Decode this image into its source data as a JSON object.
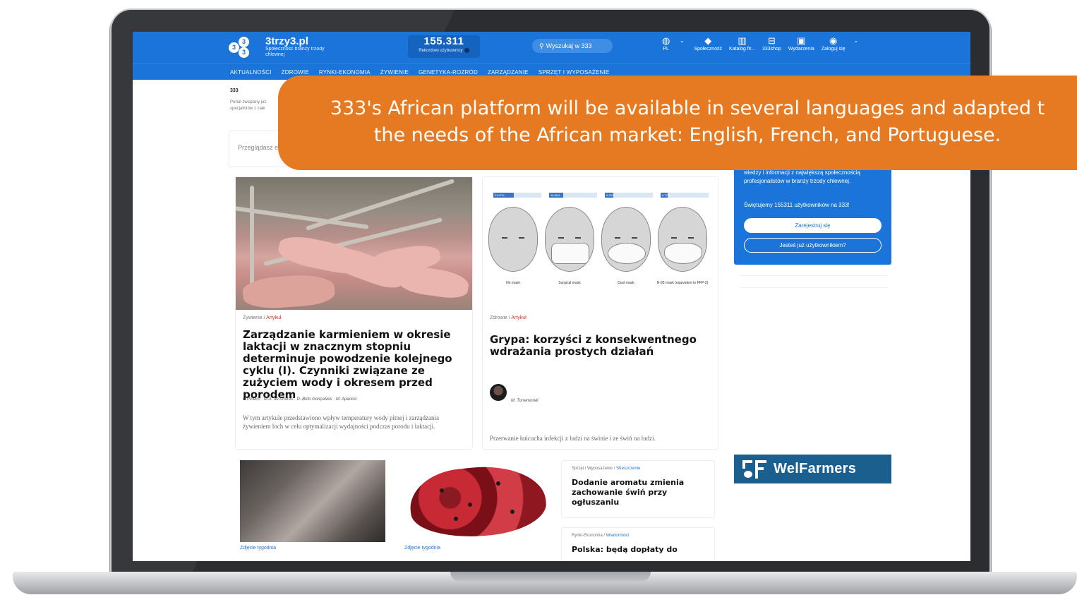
{
  "site": {
    "logo_name": "3trzy3.pl",
    "logo_tagline": "Społeczność branży trzody chlewnej",
    "counter_value": "155.311",
    "counter_label": "Rekordowi użytkownicy",
    "search_placeholder": "Wyszukaj w 333",
    "nav": [
      {
        "label": "PL",
        "icon": "globe-icon"
      },
      {
        "label": "Społeczność",
        "icon": "community-icon"
      },
      {
        "label": "Katalog fir...",
        "icon": "catalog-icon"
      },
      {
        "label": "333shop",
        "icon": "shop-icon"
      },
      {
        "label": "Wydarzenia",
        "icon": "calendar-icon"
      },
      {
        "label": "Zaloguj się",
        "icon": "user-icon"
      }
    ],
    "menu": [
      "AKTUALNOŚCI",
      "ZDROWIE",
      "RYNKI-EKONOMIA",
      "ŻYWIENIE",
      "GENETYKA-ROZRÓD",
      "ZARZĄDZANIE",
      "SPRZĘT I WYPOSAŻENIE"
    ]
  },
  "breadcrumb": "333",
  "breadcrumb_text": "Portal związany już specjalistów z całe",
  "browse_label": "Przeglądasz e",
  "banner": {
    "line1": "333's African platform will be available in several languages and adapted t",
    "line2": "the needs of the African market: English, French, and Portuguese."
  },
  "articles": [
    {
      "category": "Żywienie",
      "type": "Artykuł",
      "title": "Zarządzanie karmieniem w okresie laktacji w znacznym stopniu determinuje powodzenie kolejnego cyklu (I). Czynniki związane ze zużyciem wody i okresem przed porodem",
      "authors": "C Piñeiro · M.A. de Andrés · D. Brito Gonçalves · M. Aparicio",
      "excerpt": "W tym artykule przedstawiono wpływ temperatury wody pitnej i zarządzania żywieniem loch w celu optymalizacji wydajności podczas porodu i laktacji."
    },
    {
      "category": "Zdrowie",
      "type": "Artykuł",
      "title": "Grypa: korzyści z konsekwentnego wdrażania prostych działań",
      "authors": "M. Torremorell",
      "excerpt": "Przerwanie łańcucha infekcji z ludzi na świnie i ze świń na ludzi.",
      "figure": {
        "bars": [
          "24.07%",
          "16.66%",
          "8.33%",
          "6.77%"
        ],
        "bar_fill": [
          0.42,
          0.3,
          0.18,
          0.14
        ],
        "labels": [
          "No mask",
          "Surgical mask",
          "Dust mask",
          "N-95 mask (equivalent to FFP-2)"
        ]
      }
    }
  ],
  "photos": [
    {
      "caption": "Zdjęcie tygodnia"
    },
    {
      "caption": "Zdjęcie tygodnia"
    }
  ],
  "news": [
    {
      "category": "Sprzęt i Wyposażenie",
      "type": "Streszczenie",
      "title": "Dodanie aromatu zmienia zachowanie świń przy ogłuszaniu"
    },
    {
      "category": "Rynki-Ekonomia",
      "type": "Wiadomości",
      "title": "Polska: będą dopłaty do"
    }
  ],
  "promo": {
    "text": "wiedzy i informacji z największą społecznością profesjonalistów w branży trzody chlewnej.",
    "stat": "Świętujemy 155311 użytkowników na 333!",
    "register": "Zarejestruj się",
    "login": "Jesteś już użytkownikiem?"
  },
  "ad": {
    "name": "WelFarmers"
  },
  "colors": {
    "brand_blue": "#1b74d9",
    "banner_orange": "#e67a22",
    "ad_blue": "#1b5f8f"
  }
}
